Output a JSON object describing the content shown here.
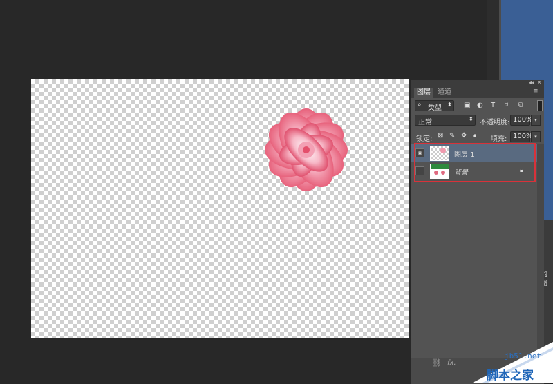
{
  "layers_panel": {
    "tabs": [
      {
        "label": "图层"
      },
      {
        "label": "通道"
      }
    ],
    "filter": {
      "label": "类型",
      "icons": [
        "image-filter-icon",
        "adjustment-filter-icon",
        "type-filter-icon",
        "shape-filter-icon",
        "smart-object-filter-icon"
      ]
    },
    "blend_mode": "正常",
    "opacity": {
      "label": "不透明度:",
      "value": "100%"
    },
    "lock": {
      "label": "锁定:"
    },
    "fill": {
      "label": "填充:",
      "value": "100%"
    },
    "layers": [
      {
        "name": "图层 1",
        "selected": true,
        "visible": true
      },
      {
        "name": "背景",
        "locked": true,
        "visible": false
      }
    ]
  },
  "background_window": {
    "label": "的图"
  },
  "watermark": {
    "url": "jb51.net",
    "brand": "脚本之家"
  },
  "colors": {
    "highlight": "#d8323a",
    "selected_row": "#596a80",
    "panel": "#535353",
    "flower": "#e8607a"
  }
}
